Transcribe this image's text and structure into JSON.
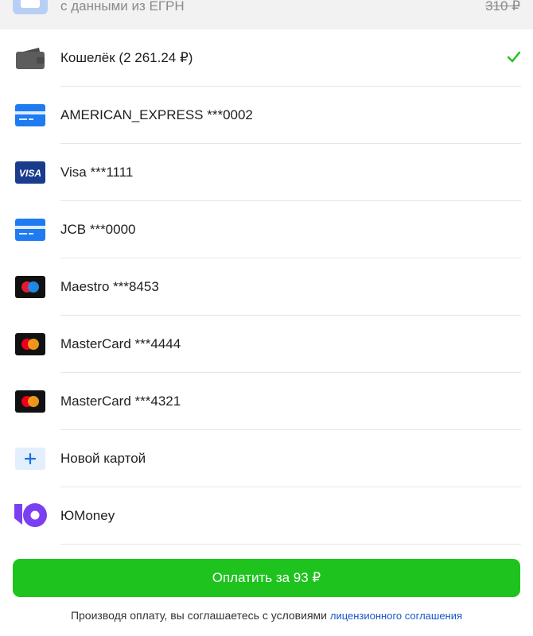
{
  "top_item": {
    "text": "с данными из ЕГРН",
    "old_price": "310 ₽"
  },
  "methods": [
    {
      "label": "Кошелёк (2 261.24 ₽)",
      "icon": "wallet-icon",
      "selected": true
    },
    {
      "label": "AMERICAN_EXPRESS ***0002",
      "icon": "card-icon",
      "selected": false
    },
    {
      "label": "Visa ***1111",
      "icon": "visa-icon",
      "selected": false
    },
    {
      "label": "JCB ***0000",
      "icon": "card-icon",
      "selected": false
    },
    {
      "label": "Maestro ***8453",
      "icon": "maestro-icon",
      "selected": false
    },
    {
      "label": "MasterCard ***4444",
      "icon": "mastercard-icon",
      "selected": false
    },
    {
      "label": "MasterCard ***4321",
      "icon": "mastercard-icon",
      "selected": false
    },
    {
      "label": "Новой картой",
      "icon": "plus-icon",
      "selected": false
    },
    {
      "label": "ЮMoney",
      "icon": "yoomoney-icon",
      "selected": false
    }
  ],
  "pay_button": {
    "label": "Оплатить за 93 ₽"
  },
  "legal": {
    "text": "Производя оплату, вы соглашаетесь с условиями",
    "link": "лицензионного соглашения"
  },
  "colors": {
    "accent_green": "#1ec31e",
    "card_blue": "#1e7bf2",
    "visa_navy": "#1a3c8c",
    "yoomoney_purple": "#7b3ff2",
    "link_blue": "#1a56c8"
  },
  "visa_logo_text": "VISA"
}
